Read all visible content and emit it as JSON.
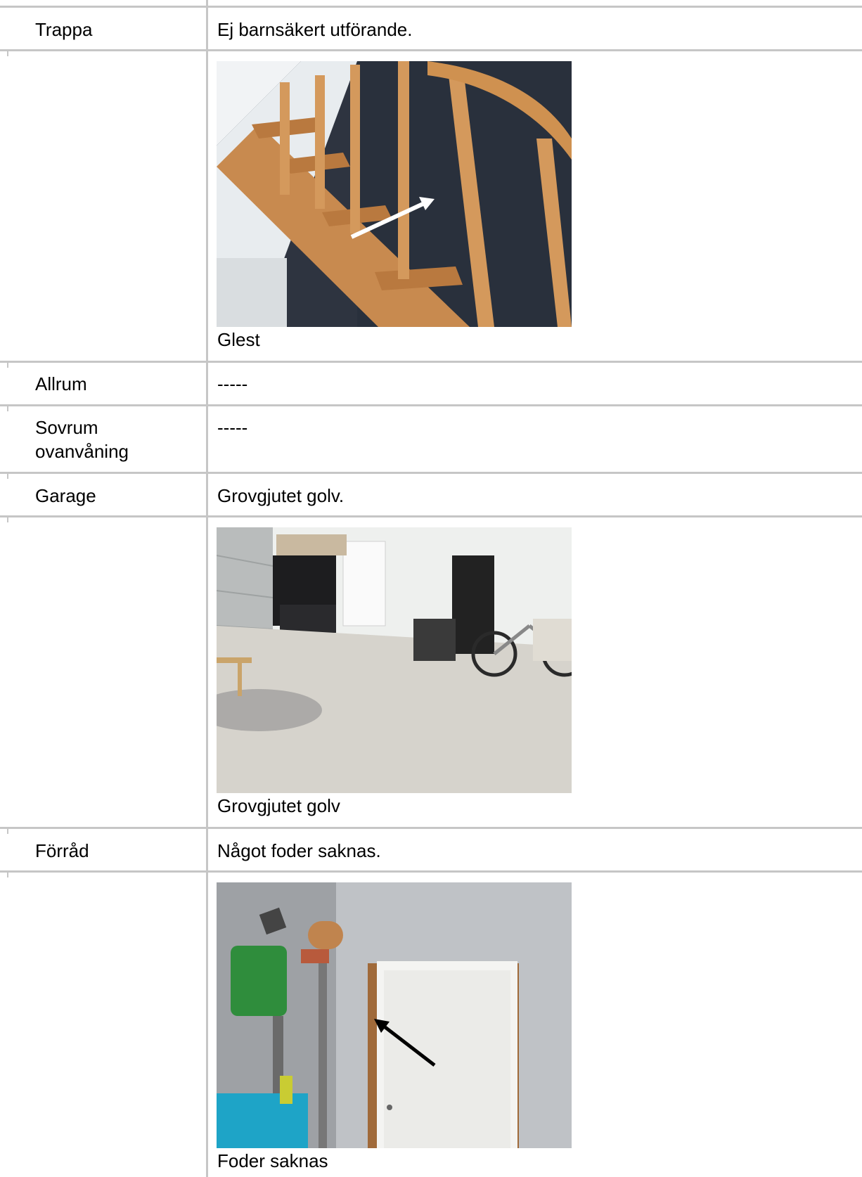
{
  "rows": [
    {
      "label": "Trappa",
      "value": "Ej barnsäkert utförande."
    },
    {
      "label": "Allrum",
      "value": "-----"
    },
    {
      "label_line1": "Sovrum",
      "label_line2": "ovanvåning",
      "value": "-----"
    },
    {
      "label": "Garage",
      "value": "Grovgjutet golv."
    },
    {
      "label": "Förråd",
      "value": "Något foder saknas."
    }
  ],
  "photos": [
    {
      "caption": "Glest",
      "icon": "staircase-photo"
    },
    {
      "caption": "Grovgjutet golv",
      "icon": "garage-photo"
    },
    {
      "caption": "Foder saknas",
      "icon": "storage-door-photo"
    }
  ]
}
